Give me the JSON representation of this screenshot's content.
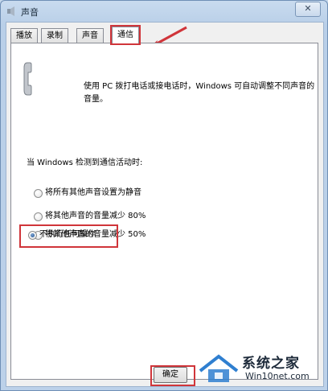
{
  "window": {
    "title": "声音",
    "close_label": "✕"
  },
  "tabs": [
    {
      "label": "播放"
    },
    {
      "label": "录制"
    },
    {
      "label": "声音"
    },
    {
      "label": "通信"
    }
  ],
  "communications": {
    "description": "使用 PC 拨打电话或接电话时，Windows 可自动调整不同声音的音量。",
    "section_label": "当 Windows 检测到通信活动时:",
    "options": [
      {
        "label": "将所有其他声音设置为静音",
        "checked": false
      },
      {
        "label": "将其他声音的音量减少 80%",
        "checked": false
      },
      {
        "label": "将其他声音的音量减少 50%",
        "checked": false
      },
      {
        "label": "不执行任何操作",
        "checked": true
      }
    ]
  },
  "buttons": {
    "ok_label": "确定"
  },
  "watermark": {
    "title": "系统之家",
    "url": "Win10net.com"
  },
  "colors": {
    "annotation_red": "#d0353a",
    "radio_selected": "#1b4e8e"
  }
}
